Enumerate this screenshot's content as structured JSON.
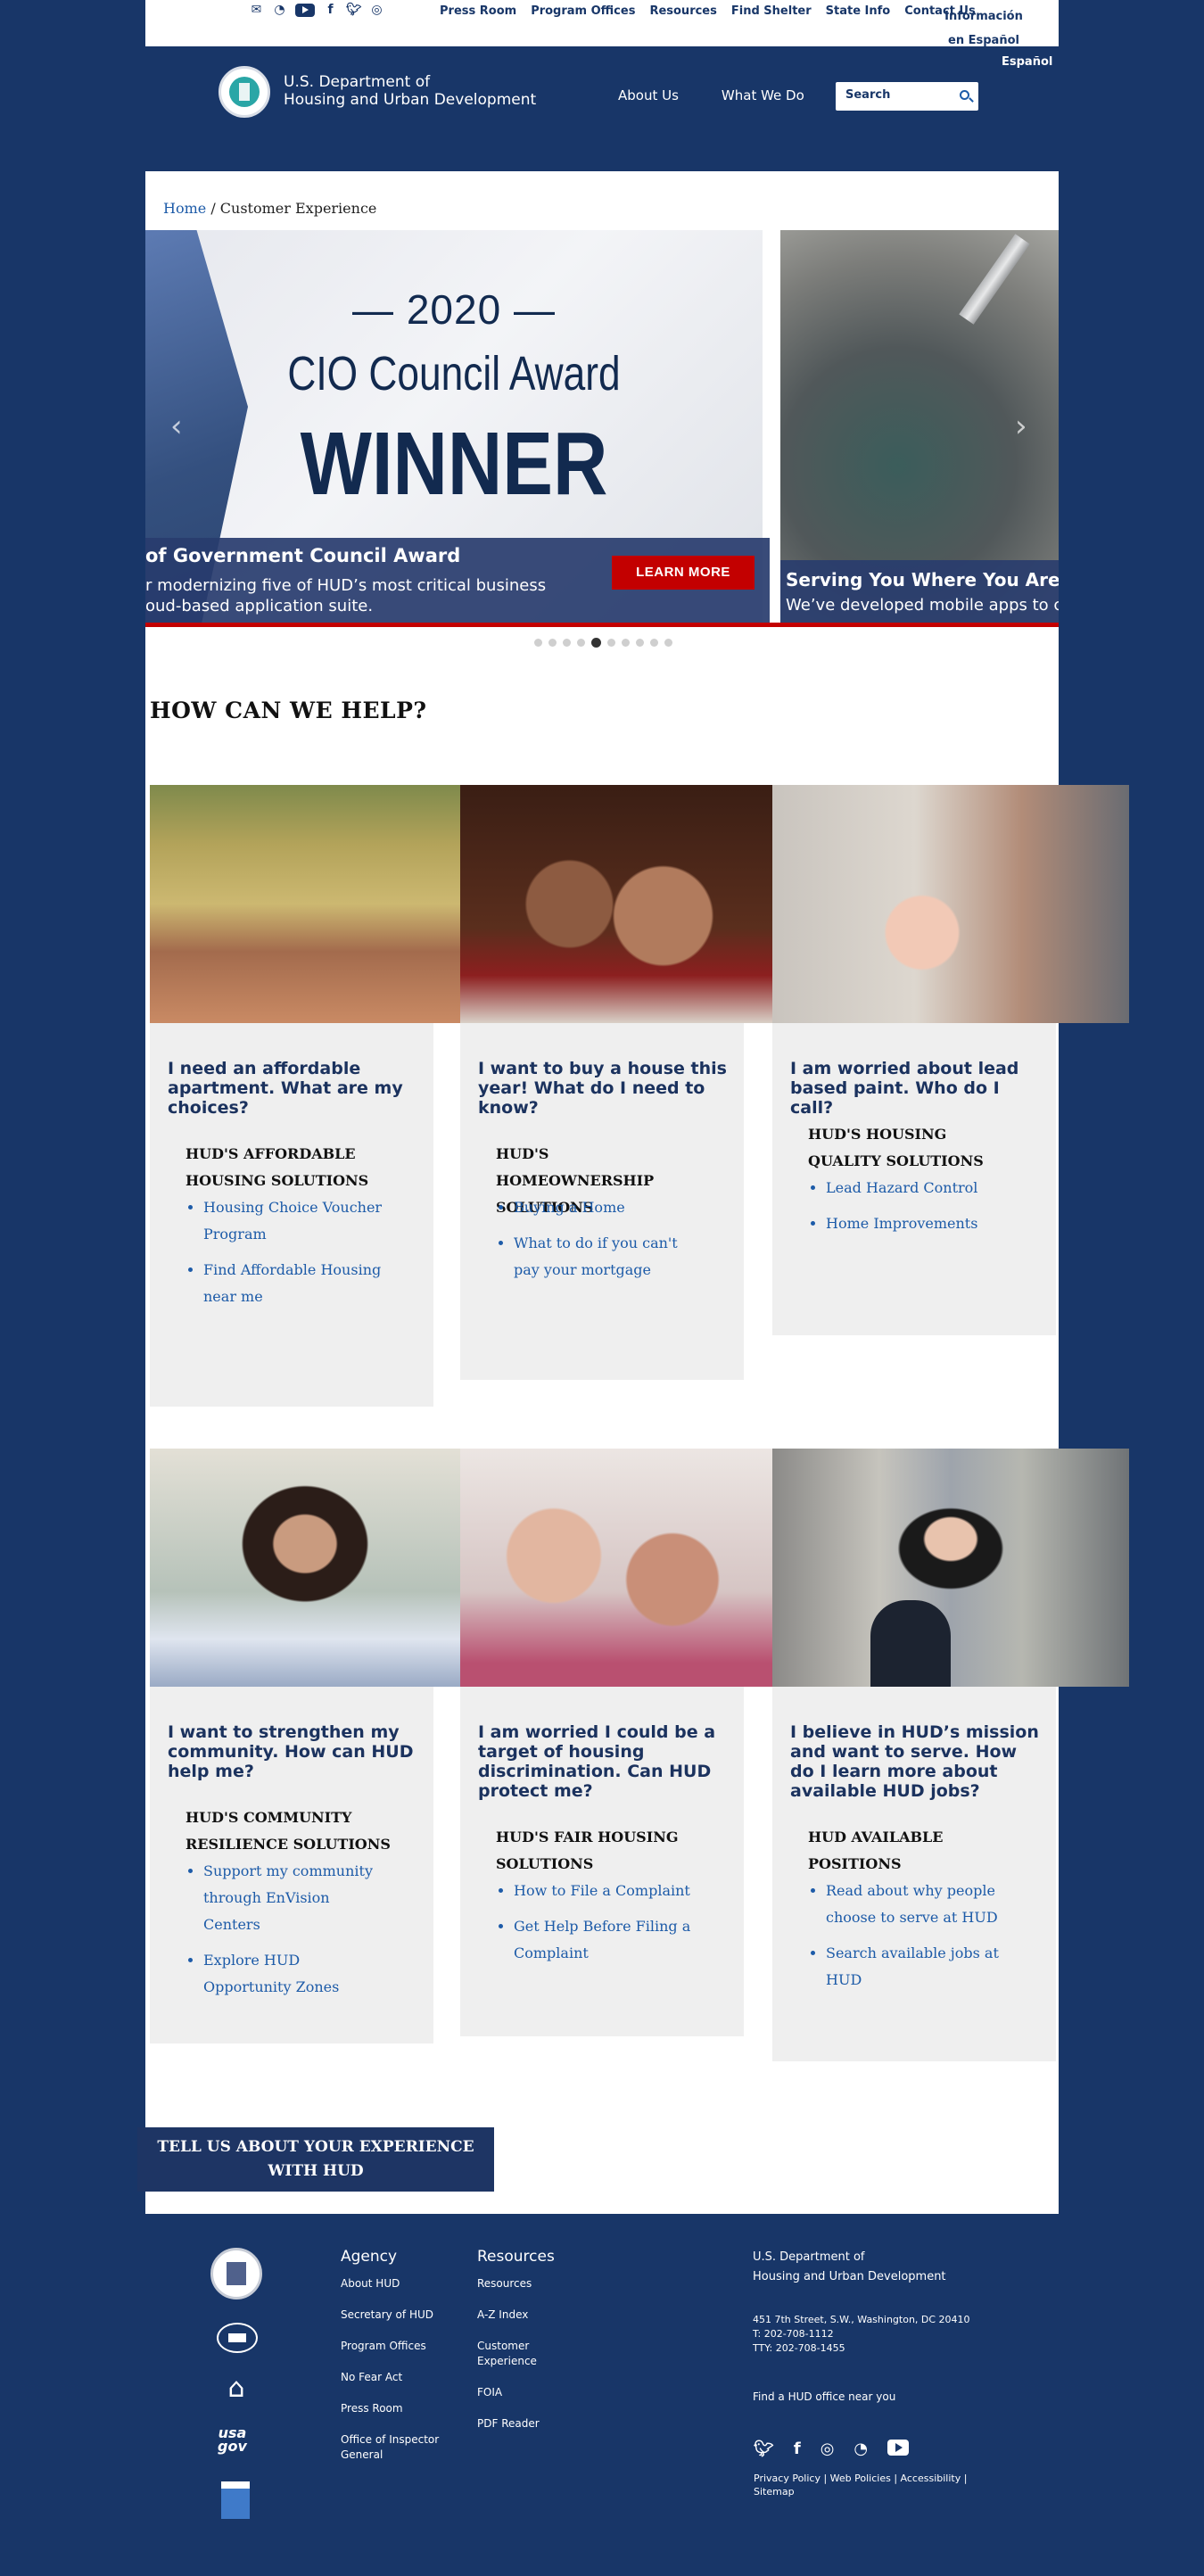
{
  "utility": {
    "nav": [
      "Press Room",
      "Program Offices",
      "Resources",
      "Find Shelter",
      "State Info",
      "Contact Us"
    ],
    "info_espanol": "Información en Español",
    "espanol": "Español",
    "social_icons": [
      "email-icon",
      "rss-icon",
      "flickr-icon",
      "youtube-icon",
      "facebook-icon",
      "twitter-icon",
      "instagram-icon"
    ]
  },
  "header": {
    "agency_line1": "U.S. Department of",
    "agency_line2": "Housing and Urban Development",
    "nav": [
      "About Us",
      "What We Do"
    ],
    "search_placeholder": "Search"
  },
  "breadcrumb": {
    "home": "Home",
    "separator": " / ",
    "current": "Customer Experience"
  },
  "carousel": {
    "slide1": {
      "year": "— 2020 —",
      "award": "CIO Council Award",
      "winner": "WINNER",
      "caption_title": "of Government Council Award",
      "caption_line1": "r modernizing five of HUD’s most critical business",
      "caption_line2": "oud-based application suite.",
      "button": "LEARN MORE"
    },
    "slide2": {
      "caption_title": "Serving You Where You Are",
      "caption_line1": "We’ve developed mobile apps to c"
    },
    "dot_count": 10,
    "active_dot": 4
  },
  "help": {
    "title": "HOW CAN WE HELP?",
    "cards": [
      {
        "question": "I need an affordable apartment. What are my choices?",
        "heading": "HUD'S AFFORDABLE HOUSING SOLUTIONS",
        "links": [
          "Housing Choice Voucher Program",
          "Find Affordable Housing near me"
        ]
      },
      {
        "question": "I want to buy a house this year! What do I need to know?",
        "heading": "HUD'S HOMEOWNERSHIP SOLUTIONS",
        "links": [
          "Buying a Home",
          "What to do if you can't pay your mortgage"
        ]
      },
      {
        "question": "I am worried about lead based paint. Who do I call?",
        "heading": "HUD'S HOUSING QUALITY SOLUTIONS",
        "links": [
          "Lead Hazard Control",
          "Home Improvements"
        ]
      },
      {
        "question": "I want to strengthen my community. How can HUD help me?",
        "heading": "HUD'S COMMUNITY RESILIENCE SOLUTIONS",
        "links": [
          "Support my community through EnVision Centers",
          "Explore HUD Opportunity Zones"
        ]
      },
      {
        "question": "I am worried I could be a target of housing discrimination. Can HUD protect me?",
        "heading": "HUD'S FAIR HOUSING SOLUTIONS",
        "links": [
          "How to File a Complaint",
          "Get Help Before Filing a Complaint"
        ]
      },
      {
        "question": "I believe in HUD’s mission and want to serve. How do I learn more about available HUD jobs?",
        "heading": "HUD AVAILABLE POSITIONS",
        "links": [
          "Read about why people choose to serve at HUD",
          "Search available jobs at HUD"
        ]
      }
    ]
  },
  "feedback_button": "TELL US ABOUT YOUR EXPERIENCE WITH HUD",
  "footer": {
    "agency": {
      "title": "Agency",
      "links": [
        "About HUD",
        "Secretary of HUD",
        "Program Offices",
        "No Fear Act",
        "Press Room",
        "Office of Inspector General"
      ]
    },
    "resources": {
      "title": "Resources",
      "links": [
        "Resources",
        "A-Z Index",
        "Customer Experience",
        "FOIA",
        "PDF Reader"
      ]
    },
    "hud_line1": "U.S. Department of",
    "hud_line2": "Housing and Urban Development",
    "address": "451 7th Street, S.W., Washington, DC 20410",
    "phone": "T: 202-708-1112",
    "tty": "TTY: 202-708-1455",
    "find_office": "Find a HUD office near you",
    "usagov": "usa gov",
    "legal": [
      "Privacy Policy",
      "Web Policies",
      "Accessibility",
      "Sitemap"
    ]
  }
}
